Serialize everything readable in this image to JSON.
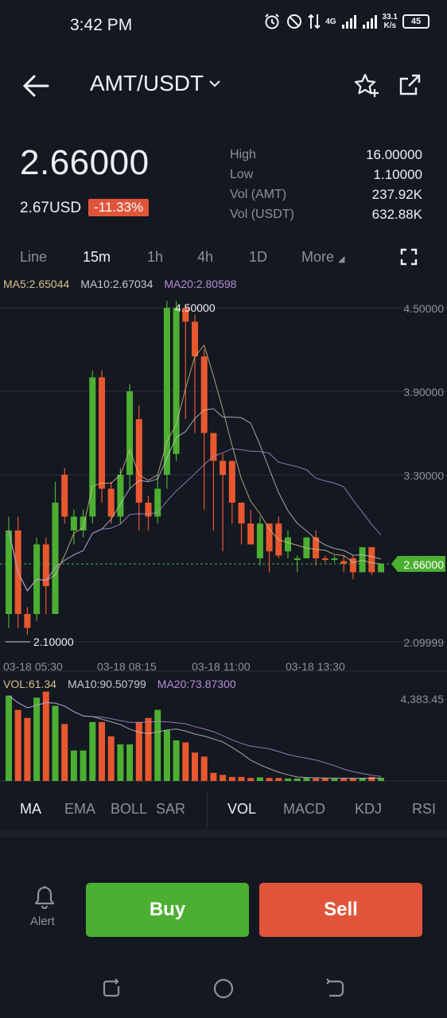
{
  "status": {
    "time": "3:42 PM",
    "network": "4G",
    "speed_value": "33.1",
    "speed_unit": "K/s",
    "battery": "45"
  },
  "header": {
    "pair": "AMT/USDT",
    "dropdown_glyph": "⌄"
  },
  "ticker": {
    "price": "2.66000",
    "usd": "2.67USD",
    "change": "-11.33%",
    "stats": [
      {
        "label": "High",
        "value": "16.00000"
      },
      {
        "label": "Low",
        "value": "1.10000"
      },
      {
        "label": "Vol (AMT)",
        "value": "237.92K"
      },
      {
        "label": "Vol (USDT)",
        "value": "632.88K"
      }
    ]
  },
  "timeframes": [
    "Line",
    "15m",
    "1h",
    "4h",
    "1D",
    "More"
  ],
  "ma_legend": {
    "ma5": "MA5:2.65044",
    "ma10": "MA10:2.67034",
    "ma20": "MA20:2.80598"
  },
  "vol_legend": {
    "vol": "VOL:61.34",
    "ma10": "MA10:90.50799",
    "ma20": "MA20:73.87300"
  },
  "colors": {
    "up": "#4caf32",
    "down": "#e8582f",
    "ma5": "#d6c38a",
    "ma10": "#c9cbd2",
    "ma20": "#b38fd6",
    "current": "#4caf32"
  },
  "chart_data": {
    "type": "candlestick",
    "y_labels": [
      "4.50000",
      "3.90000",
      "3.30000",
      "2.09999"
    ],
    "current_price_label": "2.66000",
    "high_marker": "4.50000",
    "low_marker": "2.10000",
    "x_labels": [
      "03-18 05:30",
      "03-18 08:15",
      "03-18 11:00",
      "03-18 13:30"
    ],
    "ylim": [
      2.06,
      4.6
    ],
    "candles": [
      [
        2.3,
        2.9,
        2.2,
        3.0
      ],
      [
        2.9,
        2.3,
        2.2,
        3.0
      ],
      [
        2.3,
        2.2,
        2.15,
        2.35
      ],
      [
        2.3,
        2.8,
        2.25,
        2.85
      ],
      [
        2.8,
        2.5,
        2.3,
        2.85
      ],
      [
        2.3,
        3.1,
        2.3,
        3.25
      ],
      [
        3.3,
        3.0,
        2.95,
        3.35
      ],
      [
        2.9,
        3.0,
        2.8,
        3.05
      ],
      [
        2.9,
        3.0,
        2.85,
        3.05
      ],
      [
        3.0,
        4.0,
        2.95,
        4.05
      ],
      [
        4.0,
        3.2,
        3.1,
        4.05
      ],
      [
        3.2,
        3.0,
        2.95,
        3.25
      ],
      [
        3.0,
        3.3,
        2.95,
        3.35
      ],
      [
        3.3,
        3.9,
        3.2,
        3.95
      ],
      [
        3.7,
        3.1,
        2.9,
        3.8
      ],
      [
        3.1,
        3.0,
        2.9,
        3.15
      ],
      [
        3.0,
        3.2,
        2.95,
        3.3
      ],
      [
        3.3,
        4.5,
        3.2,
        4.55
      ],
      [
        3.45,
        4.5,
        3.4,
        4.55
      ],
      [
        4.5,
        4.4,
        3.7,
        4.5
      ],
      [
        4.4,
        4.15,
        3.6,
        4.45
      ],
      [
        4.15,
        3.6,
        3.05,
        4.2
      ],
      [
        3.6,
        3.4,
        2.9,
        3.6
      ],
      [
        3.4,
        3.3,
        2.75,
        3.45
      ],
      [
        3.4,
        3.1,
        2.95,
        3.4
      ],
      [
        3.1,
        2.95,
        2.8,
        3.1
      ],
      [
        2.95,
        2.8,
        2.8,
        3.05
      ],
      [
        2.7,
        2.95,
        2.65,
        3.0
      ],
      [
        2.95,
        2.75,
        2.6,
        2.95
      ],
      [
        2.95,
        2.72,
        2.7,
        3.0
      ],
      [
        2.75,
        2.85,
        2.7,
        2.9
      ],
      [
        2.7,
        2.7,
        2.6,
        2.72
      ],
      [
        2.7,
        2.85,
        2.7,
        2.85
      ],
      [
        2.85,
        2.7,
        2.65,
        2.9
      ],
      [
        2.7,
        2.69,
        2.67,
        2.72
      ],
      [
        2.69,
        2.7,
        2.67,
        2.72
      ],
      [
        2.68,
        2.66,
        2.6,
        2.72
      ],
      [
        2.7,
        2.6,
        2.55,
        2.72
      ],
      [
        2.6,
        2.78,
        2.6,
        2.78
      ],
      [
        2.78,
        2.6,
        2.58,
        2.78
      ],
      [
        2.6,
        2.66,
        2.6,
        2.66
      ]
    ],
    "volume_label": "4,383.45",
    "volumes": [
      4200,
      3500,
      3100,
      4100,
      4400,
      3700,
      2800,
      1500,
      1500,
      2900,
      2900,
      2200,
      1800,
      1800,
      2900,
      3100,
      3500,
      2500,
      2000,
      1900,
      1400,
      1200,
      400,
      300,
      200,
      200,
      150,
      180,
      150,
      150,
      120,
      120,
      150,
      130,
      140,
      120,
      120,
      130,
      150,
      200,
      160
    ]
  },
  "indicators": {
    "main": [
      "MA",
      "EMA",
      "BOLL",
      "SAR"
    ],
    "sub": [
      "VOL",
      "MACD",
      "KDJ",
      "RSI"
    ]
  },
  "actions": {
    "alert": "Alert",
    "buy": "Buy",
    "sell": "Sell"
  }
}
